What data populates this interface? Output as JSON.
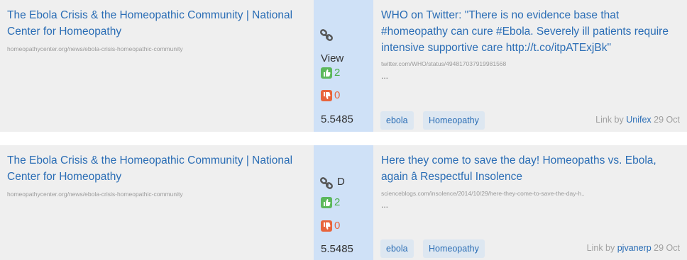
{
  "rows": [
    {
      "source_title": "The Ebola Crisis & the Homeopathic Community | National Center for Homeopathy",
      "source_url": "homeopathycenter.org/news/ebola-crisis-homeopathic-community",
      "link_label": "View",
      "upvotes": "2",
      "downvotes": "0",
      "score": "5.5485",
      "target_title": "WHO on Twitter: \"There is no evidence base that #homeopathy can cure #Ebola. Severely ill patients require intensive supportive care http://t.co/itpATExjBk\"",
      "target_url": "twitter.com/WHO/status/494817037919981568",
      "excerpt": "...",
      "tags": [
        "ebola",
        "Homeopathy"
      ],
      "link_by_prefix": "Link by",
      "user": "Unifex",
      "date": "29 Oct"
    },
    {
      "source_title": "The Ebola Crisis & the Homeopathic Community | National Center for Homeopathy",
      "source_url": "homeopathycenter.org/news/ebola-crisis-homeopathic-community",
      "link_label": "D",
      "upvotes": "2",
      "downvotes": "0",
      "score": "5.5485",
      "target_title": "Here they come to save the day! Homeopaths vs. Ebola, again â Respectful Insolence",
      "target_url": "scienceblogs.com/insolence/2014/10/29/here-they-come-to-save-the-day-h..",
      "excerpt": "...",
      "tags": [
        "ebola",
        "Homeopathy"
      ],
      "link_by_prefix": "Link by",
      "user": "pjvanerp",
      "date": "29 Oct"
    }
  ]
}
